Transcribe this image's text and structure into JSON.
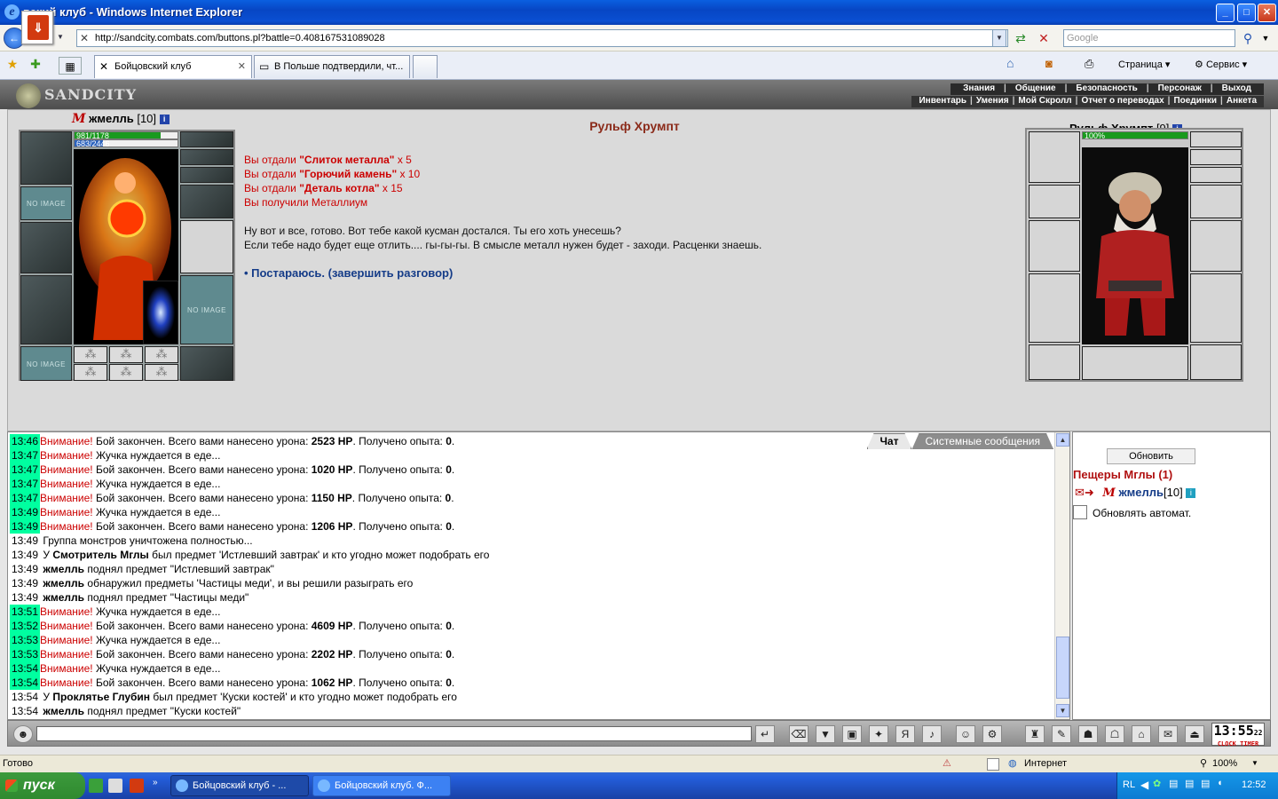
{
  "window": {
    "title": "Бойцовский клуб - Windows Internet Explorer",
    "title_visible": "вский клуб - Windows Internet Explorer",
    "minimize": "_",
    "maximize": "□",
    "close": "✕"
  },
  "address": {
    "url": "http://sandcity.combats.com/buttons.pl?battle=0.408167531089028",
    "search_placeholder": "Google"
  },
  "tabs": [
    {
      "label": "Бойцовский клуб"
    },
    {
      "label": "В Польше подтвердили, чт..."
    }
  ],
  "toolbar": {
    "page_label": "Страница",
    "service_label": "Сервис"
  },
  "site": {
    "logo_text": "SANDCITY",
    "menu_top": [
      "Знания",
      "Общение",
      "Безопасность",
      "Персонаж",
      "Выход"
    ],
    "menu_bottom": [
      "Инвентарь",
      "Умения",
      "Мой Скролл",
      "Отчет о переводах",
      "Поединки",
      "Анкета"
    ]
  },
  "player": {
    "name": "жмелль",
    "level": "[10]",
    "align_mark": "M",
    "hp_text": "981/1178",
    "hp_fraction": 0.833,
    "mana_text": "683/2446",
    "mana_fraction": 0.279,
    "no_image": "NO IMAGE"
  },
  "npc": {
    "name": "Рульф Хрумпт",
    "level": "[9]",
    "hp_text": "100%",
    "hp_fraction": 1.0
  },
  "dialog": {
    "title": "Рульф Хрумпт",
    "lines": [
      {
        "prefix": "Вы отдали ",
        "item": "\"Слиток металла\"",
        "suffix": " x 5"
      },
      {
        "prefix": "Вы отдали ",
        "item": "\"Горючий камень\"",
        "suffix": " x 10"
      },
      {
        "prefix": "Вы отдали ",
        "item": "\"Деталь котла\"",
        "suffix": " x 15"
      }
    ],
    "received": "Вы получили Металлиум",
    "text1": "Ну вот и все, готово. Вот тебе какой кусман достался. Ты его хоть унесешь?",
    "text2": "Если тебе надо будет еще отлить.... гы-гы-гы. В смысле металл нужен будет - заходи. Расценки знаешь.",
    "answer": "• Постараюсь. (завершить разговор)"
  },
  "chat": {
    "tab_chat": "Чат",
    "tab_system": "Системные сообщения",
    "rows": [
      {
        "t": "13:46",
        "hl": true,
        "w": "Внимание!",
        "a": " Бой закончен. Всего вами нанесено урона: ",
        "b": "2523 HP",
        "c": ". Получено опыта: ",
        "d": "0",
        "e": "."
      },
      {
        "t": "13:47",
        "hl": true,
        "w": "Внимание!",
        "a": " Жучка нуждается в еде...",
        "b": "",
        "c": "",
        "d": "",
        "e": ""
      },
      {
        "t": "13:47",
        "hl": true,
        "w": "Внимание!",
        "a": " Бой закончен. Всего вами нанесено урона: ",
        "b": "1020 HP",
        "c": ". Получено опыта: ",
        "d": "0",
        "e": "."
      },
      {
        "t": "13:47",
        "hl": true,
        "w": "Внимание!",
        "a": " Жучка нуждается в еде...",
        "b": "",
        "c": "",
        "d": "",
        "e": ""
      },
      {
        "t": "13:47",
        "hl": true,
        "w": "Внимание!",
        "a": " Бой закончен. Всего вами нанесено урона: ",
        "b": "1150 HP",
        "c": ". Получено опыта: ",
        "d": "0",
        "e": "."
      },
      {
        "t": "13:49",
        "hl": true,
        "w": "Внимание!",
        "a": " Жучка нуждается в еде...",
        "b": "",
        "c": "",
        "d": "",
        "e": ""
      },
      {
        "t": "13:49",
        "hl": true,
        "w": "Внимание!",
        "a": " Бой закончен. Всего вами нанесено урона: ",
        "b": "1206 HP",
        "c": ". Получено опыта: ",
        "d": "0",
        "e": "."
      },
      {
        "t": "13:49",
        "hl": false,
        "w": "",
        "a": " Группа монстров уничтожена полностью...",
        "b": "",
        "c": "",
        "d": "",
        "e": ""
      },
      {
        "t": "13:49",
        "hl": false,
        "w": "",
        "a": " У ",
        "b": "Смотритель Мглы",
        "c": " был предмет 'Истлевший завтрак' и кто угодно может подобрать его",
        "d": "",
        "e": ""
      },
      {
        "t": "13:49",
        "hl": false,
        "w": "",
        "a": " ",
        "b": "жмелль",
        "c": " поднял предмет \"Истлевший завтрак\"",
        "d": "",
        "e": ""
      },
      {
        "t": "13:49",
        "hl": false,
        "w": "",
        "a": " ",
        "b": "жмелль",
        "c": " обнаружил предметы 'Частицы меди', и вы решили разыграть его",
        "d": "",
        "e": ""
      },
      {
        "t": "13:49",
        "hl": false,
        "w": "",
        "a": " ",
        "b": "жмелль",
        "c": " поднял предмет \"Частицы меди\"",
        "d": "",
        "e": ""
      },
      {
        "t": "13:51",
        "hl": true,
        "w": "Внимание!",
        "a": " Жучка нуждается в еде...",
        "b": "",
        "c": "",
        "d": "",
        "e": ""
      },
      {
        "t": "13:52",
        "hl": true,
        "w": "Внимание!",
        "a": " Бой закончен. Всего вами нанесено урона: ",
        "b": "4609 HP",
        "c": ". Получено опыта: ",
        "d": "0",
        "e": "."
      },
      {
        "t": "13:53",
        "hl": true,
        "w": "Внимание!",
        "a": " Жучка нуждается в еде...",
        "b": "",
        "c": "",
        "d": "",
        "e": ""
      },
      {
        "t": "13:53",
        "hl": true,
        "w": "Внимание!",
        "a": " Бой закончен. Всего вами нанесено урона: ",
        "b": "2202 HP",
        "c": ". Получено опыта: ",
        "d": "0",
        "e": "."
      },
      {
        "t": "13:54",
        "hl": true,
        "w": "Внимание!",
        "a": " Жучка нуждается в еде...",
        "b": "",
        "c": "",
        "d": "",
        "e": ""
      },
      {
        "t": "13:54",
        "hl": true,
        "w": "Внимание!",
        "a": " Бой закончен. Всего вами нанесено урона: ",
        "b": "1062 HP",
        "c": ". Получено опыта: ",
        "d": "0",
        "e": "."
      },
      {
        "t": "13:54",
        "hl": false,
        "w": "",
        "a": " У ",
        "b": "Проклятье Глубин",
        "c": " был предмет 'Куски костей' и кто угодно может подобрать его",
        "d": "",
        "e": ""
      },
      {
        "t": "13:54",
        "hl": false,
        "w": "",
        "a": " ",
        "b": "жмелль",
        "c": " поднял предмет \"Куски костей\"",
        "d": "",
        "e": ""
      }
    ]
  },
  "side": {
    "refresh_label": "Обновить",
    "location": "Пещеры Мглы (1)",
    "nick": "жмелль",
    "nick_level": "[10]",
    "auto_label": "Обновлять автомат."
  },
  "clock": {
    "time": "13:55",
    "seconds": "22",
    "label": "CLOCK TIMER"
  },
  "statusbar": {
    "status": "Готово",
    "zone": "Интернет",
    "zoom": "100%"
  },
  "taskbar": {
    "start": "пуск",
    "tasks": [
      "Бойцовский клуб - ...",
      "Бойцовский клуб. Ф..."
    ],
    "lang": "RL",
    "time": "12:52"
  }
}
